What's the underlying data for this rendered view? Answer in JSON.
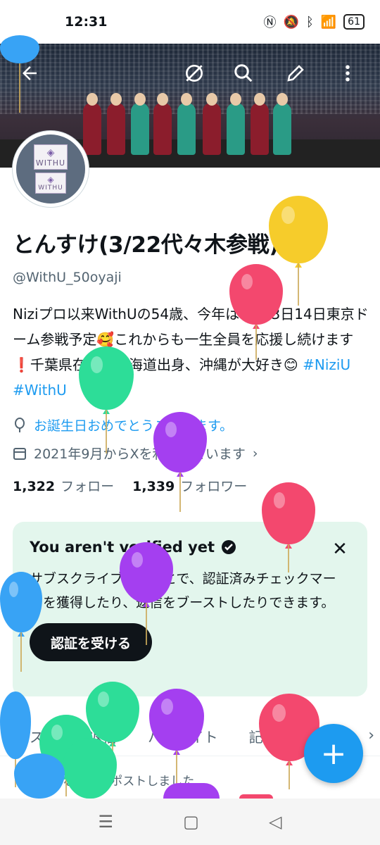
{
  "status_bar": {
    "time": "12:31",
    "battery": "61"
  },
  "profile": {
    "name": "とんすけ(3/22代々木参戦)",
    "handle": "@WithU_50oyaji",
    "bio_text": "Niziプロ以来WithUの54歳、今年は6月13日14日東京ドーム参戦予定🥰これからも一生全員を応援し続けます❗千葉県在住、北海道出身、沖縄が大好き😊",
    "hashtags": [
      "#NiziU",
      "#WithU"
    ],
    "birthday_text": "お誕生日おめでとうございます。",
    "joined_text": "2021年9月からXを利用しています",
    "following_count": "1,322",
    "following_label": "フォロー",
    "followers_count": "1,339",
    "followers_label": "フォロワー",
    "avatar_logo_text": "WITHU"
  },
  "verify_card": {
    "title": "You aren't verified yet",
    "body": "サブスクライブすることで、認証済みチェックマークを獲得したり、返信をブーストしたりできます。",
    "button": "認証を受ける"
  },
  "tabs": [
    "ポスト",
    "返信",
    "ハイライト",
    "記"
  ],
  "repost_label": "あなたがリポストしました",
  "icons": {
    "back": "back-arrow-icon",
    "grok": "grok-icon",
    "search": "search-icon",
    "edit": "edit-icon",
    "more": "more-vert-icon"
  },
  "colors": {
    "accent": "#1d9bf0",
    "card_bg": "#e3f6ed"
  }
}
